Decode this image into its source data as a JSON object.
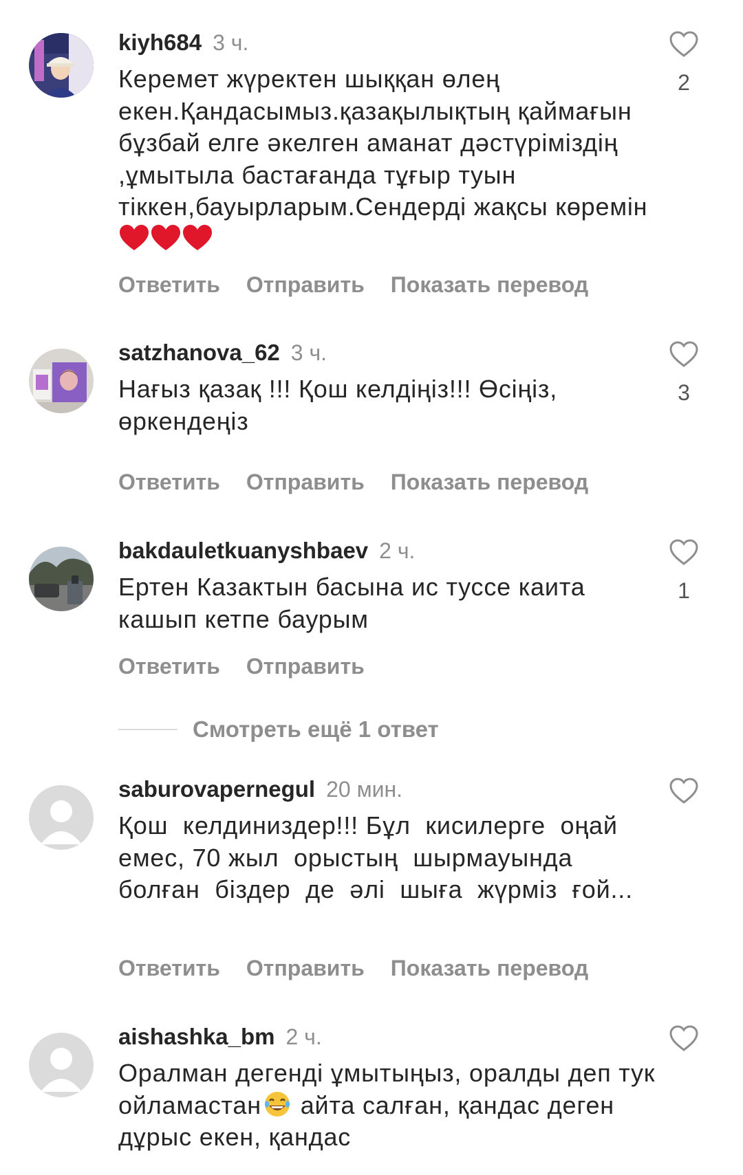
{
  "comments": [
    {
      "username": "kiyh684",
      "time": "3 ч.",
      "text": "Керемет жүректен шыққан өлең екен.Қандасымыз.қазақылықтың қаймағын бұзбай елге әкелген аманат дәстүріміздің ,ұмытыла бастағанда тұғыр туын тіккен,бауырларым.Сендерді жақсы көремін",
      "emoji": "heart-emoji",
      "likes": "2",
      "reply": "Ответить",
      "send": "Отправить",
      "translate": "Показать перевод"
    },
    {
      "username": "satzhanova_62",
      "time": "3 ч.",
      "text": "Нағыз қазақ !!! Қош келдіңіз!!! Өсіңіз, өркендеңіз",
      "likes": "3",
      "reply": "Ответить",
      "send": "Отправить",
      "translate": "Показать перевод"
    },
    {
      "username": "bakdauletkuanyshbaev",
      "time": "2 ч.",
      "text": "Ертен Казактын басына ис туссе каита кашып кетпе баурым",
      "likes": "1",
      "reply": "Ответить",
      "send": "Отправить"
    },
    {
      "username": "saburovapernegul",
      "time": "20 мин.",
      "text": "Қош  келдиниздер!!! Бұл  кисилерге  оңай  емес, 70 жыл  орыстың  шырмауында  болған  біздер  де  әлі  шыға  жүрміз  ғой...",
      "reply": "Ответить",
      "send": "Отправить",
      "translate": "Показать перевод"
    },
    {
      "username": "aishashka_bm",
      "time": "2 ч.",
      "text_part1": "Оралман дегенді ұмытыңыз, оралды деп тук ойламастан",
      "emoji": "laughing-emoji",
      "text_part2": " айта салған, қандас деген  дұрыс екен, қандас"
    }
  ],
  "view_more_replies": "Смотреть ещё 1 ответ",
  "colors": {
    "text": "#262626",
    "secondary": "#8e8e8e",
    "heart_emoji": "#e0162b",
    "divider": "#dbdbdb"
  }
}
